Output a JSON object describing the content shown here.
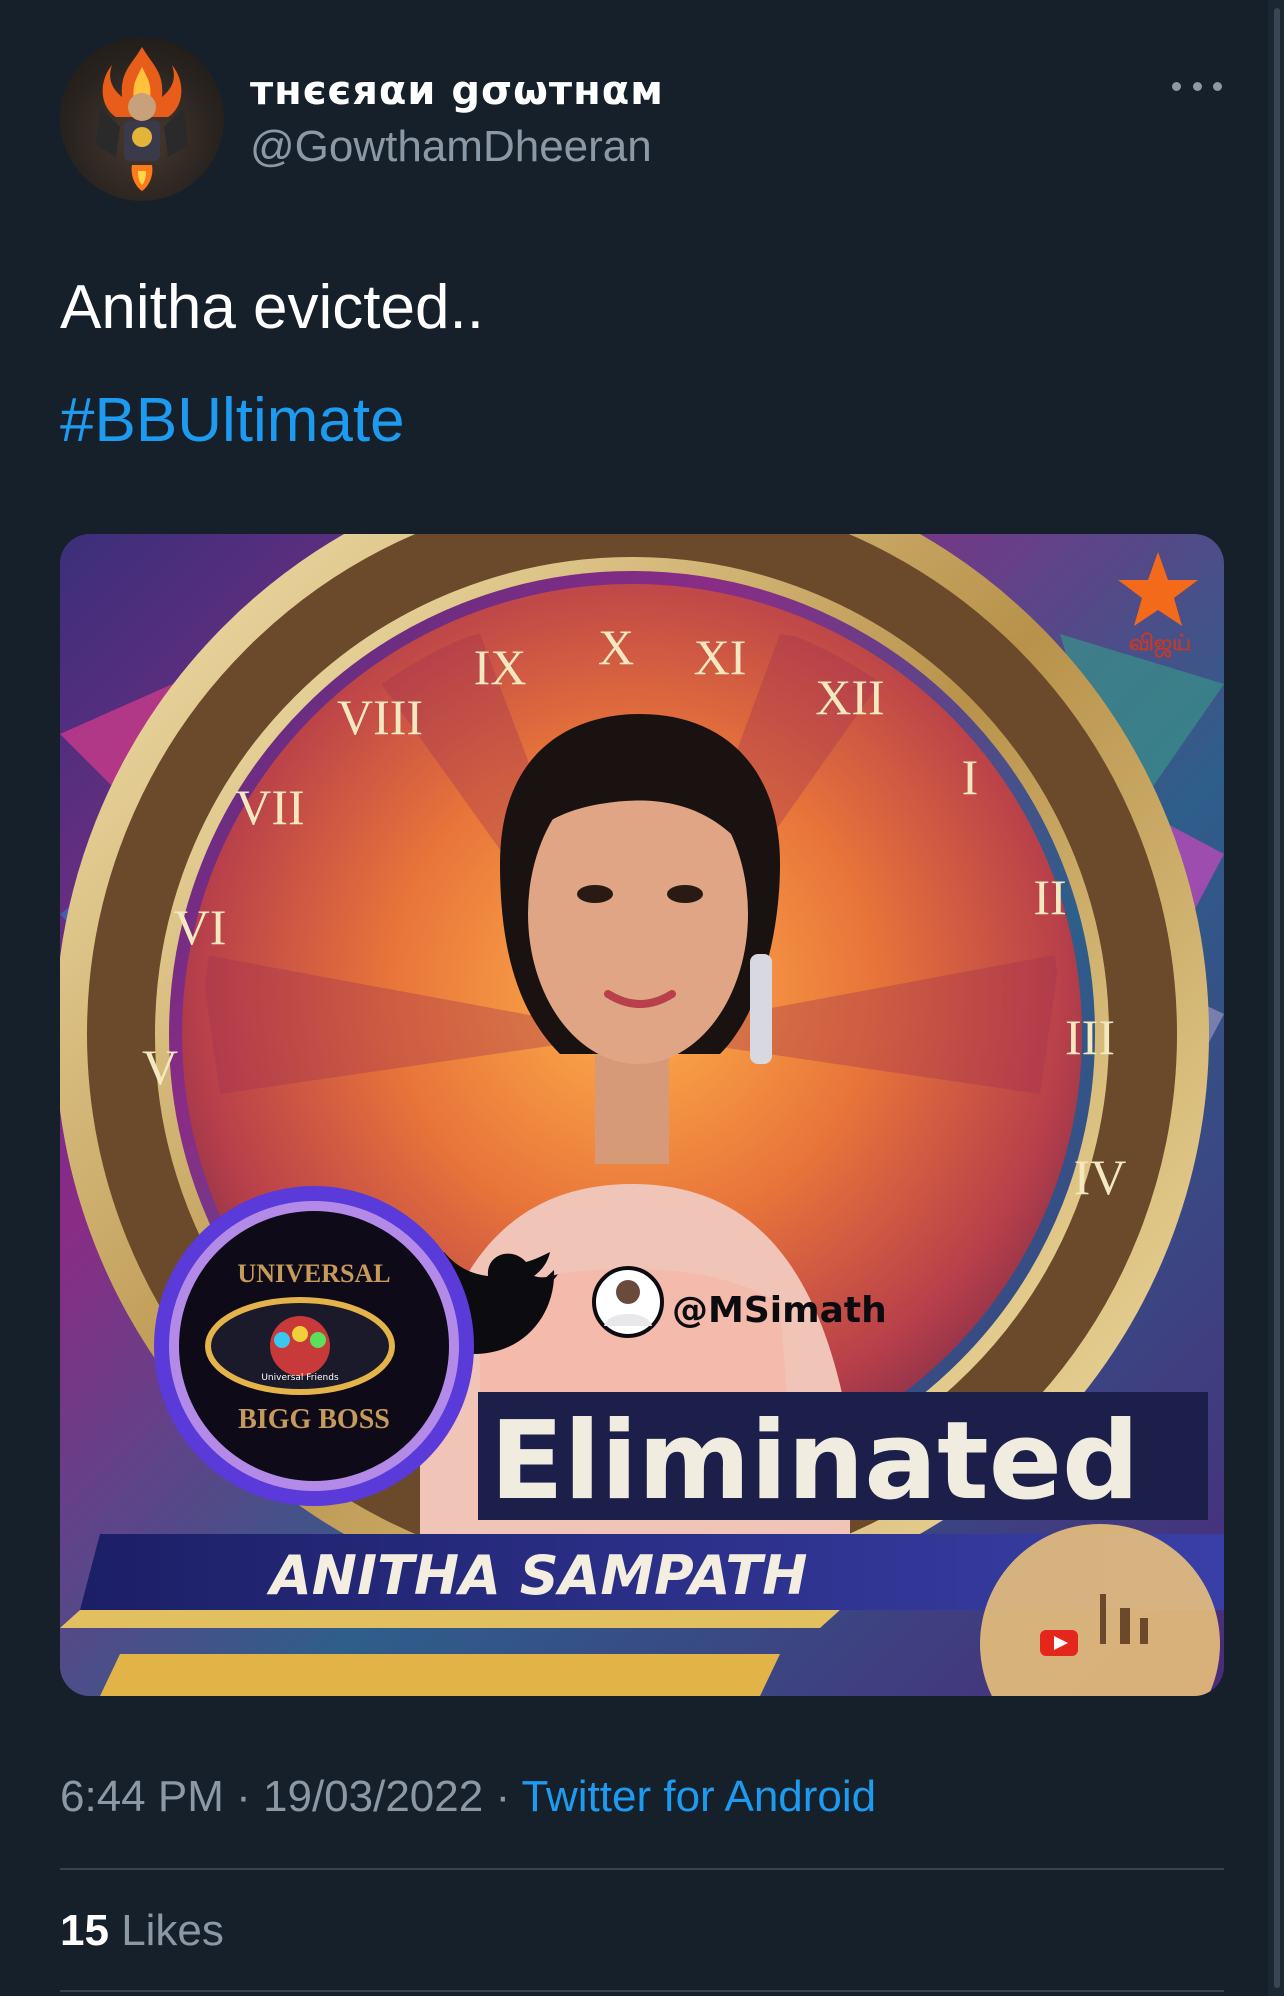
{
  "author": {
    "display_name": "тнєєяαи gσωтнαм",
    "handle": "@GowthamDheeran"
  },
  "tweet": {
    "text": "Anitha evicted..",
    "hashtag": "#BBUltimate"
  },
  "media": {
    "watermark_handle": "@MSimath",
    "badge_top": "UNIVERSAL",
    "badge_bottom": "BIGG BOSS",
    "badge_inner": "Universal Friends",
    "headline": "Eliminated",
    "contestant_name": "ANITHA SAMPATH",
    "channel_logo": "விஜய்",
    "clock_numerals": [
      "X",
      "XI",
      "XII",
      "I",
      "II",
      "III",
      "IV",
      "V",
      "VI",
      "VII",
      "VIII",
      "IX"
    ]
  },
  "footer": {
    "time": "6:44 PM",
    "date": "19/03/2022",
    "separator": "·",
    "source": "Twitter for Android",
    "likes_count": "15",
    "likes_label": "Likes"
  },
  "icons": [
    "more-icon",
    "twitter-bird-icon",
    "youtube-icon",
    "star-icon"
  ],
  "colors": {
    "background": "#15202b",
    "link": "#1d9bf0",
    "secondary_text": "#8b98a5",
    "divider": "#38444d"
  }
}
